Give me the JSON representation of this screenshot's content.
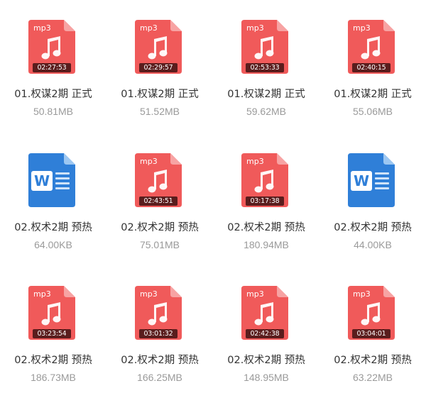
{
  "files": [
    {
      "type": "mp3",
      "icon": "mp3-file-icon",
      "ext_label": "mp3",
      "duration": "02:27:53",
      "name": "01.权谋2期 正式",
      "size": "50.81MB"
    },
    {
      "type": "mp3",
      "icon": "mp3-file-icon",
      "ext_label": "mp3",
      "duration": "02:29:57",
      "name": "01.权谋2期 正式",
      "size": "51.52MB"
    },
    {
      "type": "mp3",
      "icon": "mp3-file-icon",
      "ext_label": "mp3",
      "duration": "02:53:33",
      "name": "01.权谋2期 正式",
      "size": "59.62MB"
    },
    {
      "type": "mp3",
      "icon": "mp3-file-icon",
      "ext_label": "mp3",
      "duration": "02:40:15",
      "name": "01.权谋2期 正式",
      "size": "55.06MB"
    },
    {
      "type": "word",
      "icon": "word-file-icon",
      "ext_label": "W",
      "duration": "",
      "name": "02.权术2期 预热",
      "size": "64.00KB"
    },
    {
      "type": "mp3",
      "icon": "mp3-file-icon",
      "ext_label": "mp3",
      "duration": "02:43:51",
      "name": "02.权术2期 预热",
      "size": "75.01MB"
    },
    {
      "type": "mp3",
      "icon": "mp3-file-icon",
      "ext_label": "mp3",
      "duration": "03:17:38",
      "name": "02.权术2期 预热",
      "size": "180.94MB"
    },
    {
      "type": "word",
      "icon": "word-file-icon",
      "ext_label": "W",
      "duration": "",
      "name": "02.权术2期 预热",
      "size": "44.00KB"
    },
    {
      "type": "mp3",
      "icon": "mp3-file-icon",
      "ext_label": "mp3",
      "duration": "03:23:54",
      "name": "02.权术2期 预热",
      "size": "186.73MB"
    },
    {
      "type": "mp3",
      "icon": "mp3-file-icon",
      "ext_label": "mp3",
      "duration": "03:01:32",
      "name": "02.权术2期 预热",
      "size": "166.25MB"
    },
    {
      "type": "mp3",
      "icon": "mp3-file-icon",
      "ext_label": "mp3",
      "duration": "02:42:38",
      "name": "02.权术2期 预热",
      "size": "148.95MB"
    },
    {
      "type": "mp3",
      "icon": "mp3-file-icon",
      "ext_label": "mp3",
      "duration": "03:04:01",
      "name": "02.权术2期 预热",
      "size": "63.22MB"
    }
  ],
  "colors": {
    "mp3_body": "#f05a5a",
    "mp3_fold": "#f7a3a3",
    "word_body": "#2f7fd8",
    "word_fold": "#9cc7f2",
    "duration_bg": "#5a1d1d"
  }
}
